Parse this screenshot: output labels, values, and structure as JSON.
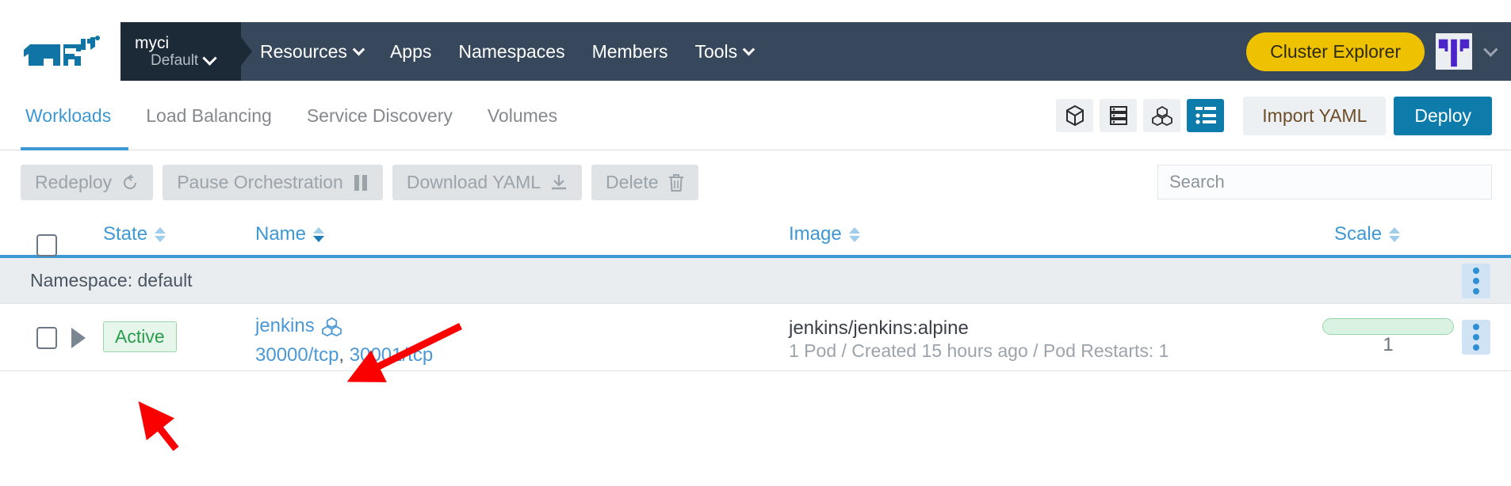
{
  "brand": {
    "logo_icon": "rancher-cow-logo",
    "accent_blue": "#0d7cab",
    "header_bg": "#37485c",
    "cluster_pill_bg": "#1c2936",
    "yellow": "#eec200",
    "link_blue": "#4b98d6",
    "tab_active": "#3d98d3",
    "annotation_red": "#fa0000"
  },
  "topnav": {
    "cluster": {
      "name": "myci",
      "project": "Default",
      "chevron_icon": "chevron-down-icon"
    },
    "links": [
      {
        "label": "Resources",
        "has_chevron": true
      },
      {
        "label": "Apps",
        "has_chevron": false
      },
      {
        "label": "Namespaces",
        "has_chevron": false
      },
      {
        "label": "Members",
        "has_chevron": false
      },
      {
        "label": "Tools",
        "has_chevron": true
      }
    ],
    "cluster_explorer_label": "Cluster Explorer",
    "avatar_icon": "user-identicon-avatar",
    "avatar_chevron_icon": "chevron-down-icon"
  },
  "tabbar": {
    "tabs": [
      {
        "label": "Workloads",
        "active": true
      },
      {
        "label": "Load Balancing",
        "active": false
      },
      {
        "label": "Service Discovery",
        "active": false
      },
      {
        "label": "Volumes",
        "active": false
      }
    ],
    "view_modes": [
      {
        "icon": "cube-icon",
        "active": false
      },
      {
        "icon": "server-stack-icon",
        "active": false
      },
      {
        "icon": "cluster-nodes-icon",
        "active": false
      },
      {
        "icon": "list-view-icon",
        "active": true
      }
    ],
    "import_yaml_label": "Import YAML",
    "deploy_label": "Deploy"
  },
  "actionbar": {
    "buttons": [
      {
        "label": "Redeploy",
        "icon": "redeploy-icon",
        "disabled": true
      },
      {
        "label": "Pause Orchestration",
        "icon": "pause-icon",
        "disabled": true
      },
      {
        "label": "Download YAML",
        "icon": "download-icon",
        "disabled": true
      },
      {
        "label": "Delete",
        "icon": "trash-icon",
        "disabled": true
      }
    ],
    "search": {
      "value": "",
      "placeholder": "Search"
    }
  },
  "table": {
    "columns": [
      {
        "label": "State",
        "sortable": true,
        "sorted": false
      },
      {
        "label": "Name",
        "sortable": true,
        "sorted": true
      },
      {
        "label": "Image",
        "sortable": true,
        "sorted": false
      },
      {
        "label": "Scale",
        "sortable": true,
        "sorted": false
      }
    ],
    "group": {
      "label": "Namespace: default",
      "kebab_icon": "kebab-menu-icon"
    },
    "rows": [
      {
        "state": "Active",
        "name": "jenkins",
        "name_icon": "cluster-nodes-icon",
        "ports": [
          "30000/tcp",
          "30001/tcp"
        ],
        "ports_separator": ", ",
        "image": "jenkins/jenkins:alpine",
        "image_sub": "1 Pod / Created 15 hours ago / Pod Restarts: 1",
        "scale": "1",
        "expand_icon": "expand-triangle-icon",
        "kebab_icon": "kebab-menu-icon"
      }
    ]
  },
  "annotations": [
    {
      "name": "arrow-to-name-icon",
      "color": "#fa0000"
    },
    {
      "name": "arrow-to-state-badge",
      "color": "#fa0000"
    }
  ]
}
